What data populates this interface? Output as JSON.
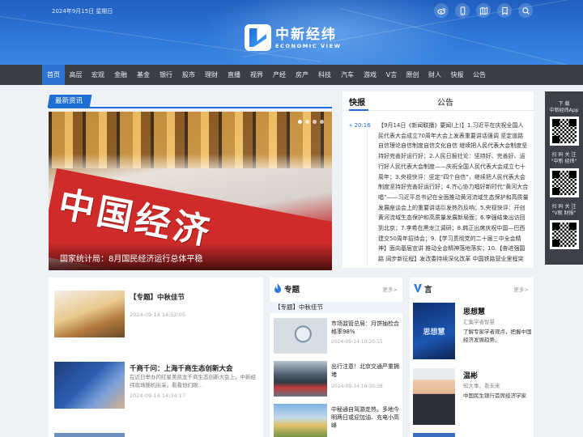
{
  "header": {
    "date": "2024年9月15日 星期日",
    "logo_cn": "中新经纬",
    "logo_en": "ECONOMIC VIEW",
    "icons": [
      "weibo-icon",
      "mobile-icon",
      "map-icon",
      "bookmark-icon",
      "search-icon"
    ]
  },
  "nav": {
    "items": [
      "首页",
      "高层",
      "宏观",
      "金融",
      "基金",
      "银行",
      "股市",
      "理财",
      "直播",
      "视界",
      "产经",
      "房产",
      "科技",
      "汽车",
      "游戏",
      "V言",
      "原创",
      "财人",
      "快报",
      "公告"
    ],
    "active_index": 0
  },
  "latest": {
    "tag": "最新资讯",
    "banner_text": "中国经济",
    "caption": "国家统计局：8月国民经济运行总体平稳"
  },
  "flash": {
    "tab1": "快报",
    "tab2": "公告",
    "time": "20:16",
    "text": "【9月14日《新闻联播》要闻(上)】1.习近平在庆祝全国人民代表大会成立70周年大会上发表重要讲话强调 坚定道路自信理论自信制度自信文化自信 继续把人民代表大会制度坚持好完善好运行好；2.人民日报社论：坚持好、完善好、运行好人民代表大会制度——庆祝全国人民代表大会成立七十周年；3.央视快评：坚定“四个自信”，继续把人民代表大会制度坚持好完善好运行好；4.齐心协力唱好新时代“黄河大合唱”——习近平总书记在全面推动黄河流域生态保护和高质量发展座谈会上的重要讲话引发热烈反响；5.央视快评：开创黄河流域生态保护和高质量发展新局面；6.李强结束出访回到北京；7.李希在黑龙江调研；8.韩正出席庆祝中国—巴西建交50周年招待会；9.【学习贯彻党的二十届三中全会精神】面向基层宣讲 推动全会精神落地落实；10.【奋进强国路 阔步新征程】发改委持续深化改革 中国铁路营业里程突"
  },
  "sidebar": {
    "qr1_label": "下 载\n中新经纬App",
    "qr2_label": "扫 码 关 注\n\"中新 经纬\"",
    "qr3_label": "扫 码 关 注\n\"V观 财报\""
  },
  "news_list": [
    {
      "title": "【专题】中秋佳节",
      "summary": "",
      "time": "2024-09-14 14:52:05"
    },
    {
      "title": "千商千问：上海千商生态创新大会",
      "summary": "在近日举办的红星美凯龙千商生态创新大会上，中新经纬现场随机街采，看看他们眼...",
      "time": "2024-09-14 14:34:17"
    },
    {
      "title": "",
      "summary": "",
      "time": ""
    }
  ],
  "topic": {
    "title": "专题",
    "more": "更多>",
    "subtitle": "【专题】中秋佳节",
    "items": [
      {
        "title": "市场监管总局：月饼抽检合格率98%",
        "time": "2024-09-14 10:20:15"
      },
      {
        "title": "出行注意！北京交通严重拥堵",
        "time": "2024-09-14 16:30:38"
      },
      {
        "title": "中秘通自驾游走热，多地今明两日或迎加油、充电小高峰",
        "time": ""
      }
    ]
  },
  "opinion": {
    "title": "言",
    "more": "更多>",
    "items": [
      {
        "name": "思想慧",
        "role": "汇集学者智慧",
        "desc": "了解专家学者观点，把握中国经济发展趋势。",
        "img_text": "思想慧"
      },
      {
        "name": "温彬",
        "role": "知大事，看未来",
        "desc": "中国民生银行首席经济学家",
        "img_text": ""
      }
    ]
  },
  "colors": {
    "brand_blue": "#1f6ed4",
    "nav_bg": "#3a3f47",
    "nav_active": "#2c73d2"
  }
}
